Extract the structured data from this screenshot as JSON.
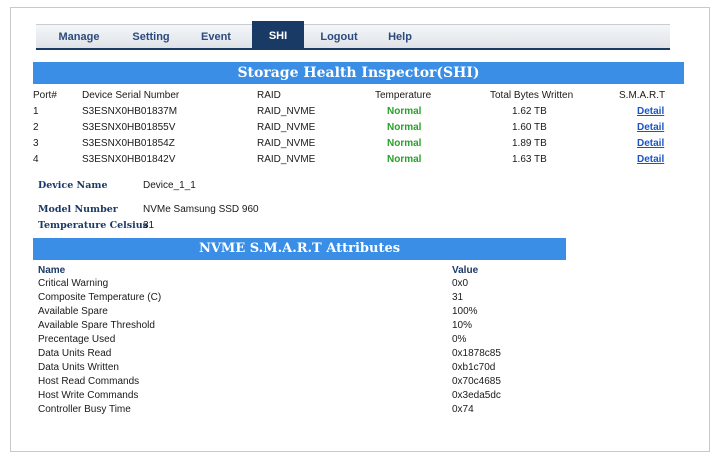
{
  "nav": {
    "items": [
      "Manage",
      "Setting",
      "Event",
      "SHI",
      "Logout",
      "Help"
    ],
    "active": "SHI"
  },
  "shi": {
    "title": "Storage Health Inspector(SHI)",
    "headers": [
      "Port#",
      "Device Serial Number",
      "RAID",
      "Temperature",
      "Total Bytes Written",
      "S.M.A.R.T"
    ],
    "rows": [
      {
        "port": "1",
        "serial": "S3ESNX0HB01837M",
        "raid": "RAID_NVME",
        "temp": "Normal",
        "tbw": "1.62 TB",
        "smart": "Detail"
      },
      {
        "port": "2",
        "serial": "S3ESNX0HB01855V",
        "raid": "RAID_NVME",
        "temp": "Normal",
        "tbw": "1.60 TB",
        "smart": "Detail"
      },
      {
        "port": "3",
        "serial": "S3ESNX0HB01854Z",
        "raid": "RAID_NVME",
        "temp": "Normal",
        "tbw": "1.89 TB",
        "smart": "Detail"
      },
      {
        "port": "4",
        "serial": "S3ESNX0HB01842V",
        "raid": "RAID_NVME",
        "temp": "Normal",
        "tbw": "1.63 TB",
        "smart": "Detail"
      }
    ]
  },
  "device": {
    "name_label": "Device Name",
    "name_value": "Device_1_1",
    "model_label": "Model Number",
    "model_value": "NVMe Samsung SSD 960",
    "temp_label": "Temperature Celsius",
    "temp_value": "31"
  },
  "smart": {
    "title": "NVME S.M.A.R.T Attributes",
    "name_header": "Name",
    "value_header": "Value",
    "attributes": [
      {
        "name": "Critical Warning",
        "value": "0x0"
      },
      {
        "name": "Composite Temperature (C)",
        "value": "31"
      },
      {
        "name": "Available Spare",
        "value": "100%"
      },
      {
        "name": "Available Spare Threshold",
        "value": "10%"
      },
      {
        "name": "Precentage Used",
        "value": "0%"
      },
      {
        "name": "Data Units Read",
        "value": "0x1878c85"
      },
      {
        "name": "Data Units Written",
        "value": "0xb1c70d"
      },
      {
        "name": "Host Read Commands",
        "value": "0x70c4685"
      },
      {
        "name": "Host Write Commands",
        "value": "0x3eda5dc"
      },
      {
        "name": "Controller Busy Time",
        "value": "0x74"
      }
    ]
  },
  "colors": {
    "header_blue": "#3a8ee6",
    "nav_active": "#1a3a66",
    "status_green": "#27a327",
    "link_blue": "#1a55c7"
  }
}
